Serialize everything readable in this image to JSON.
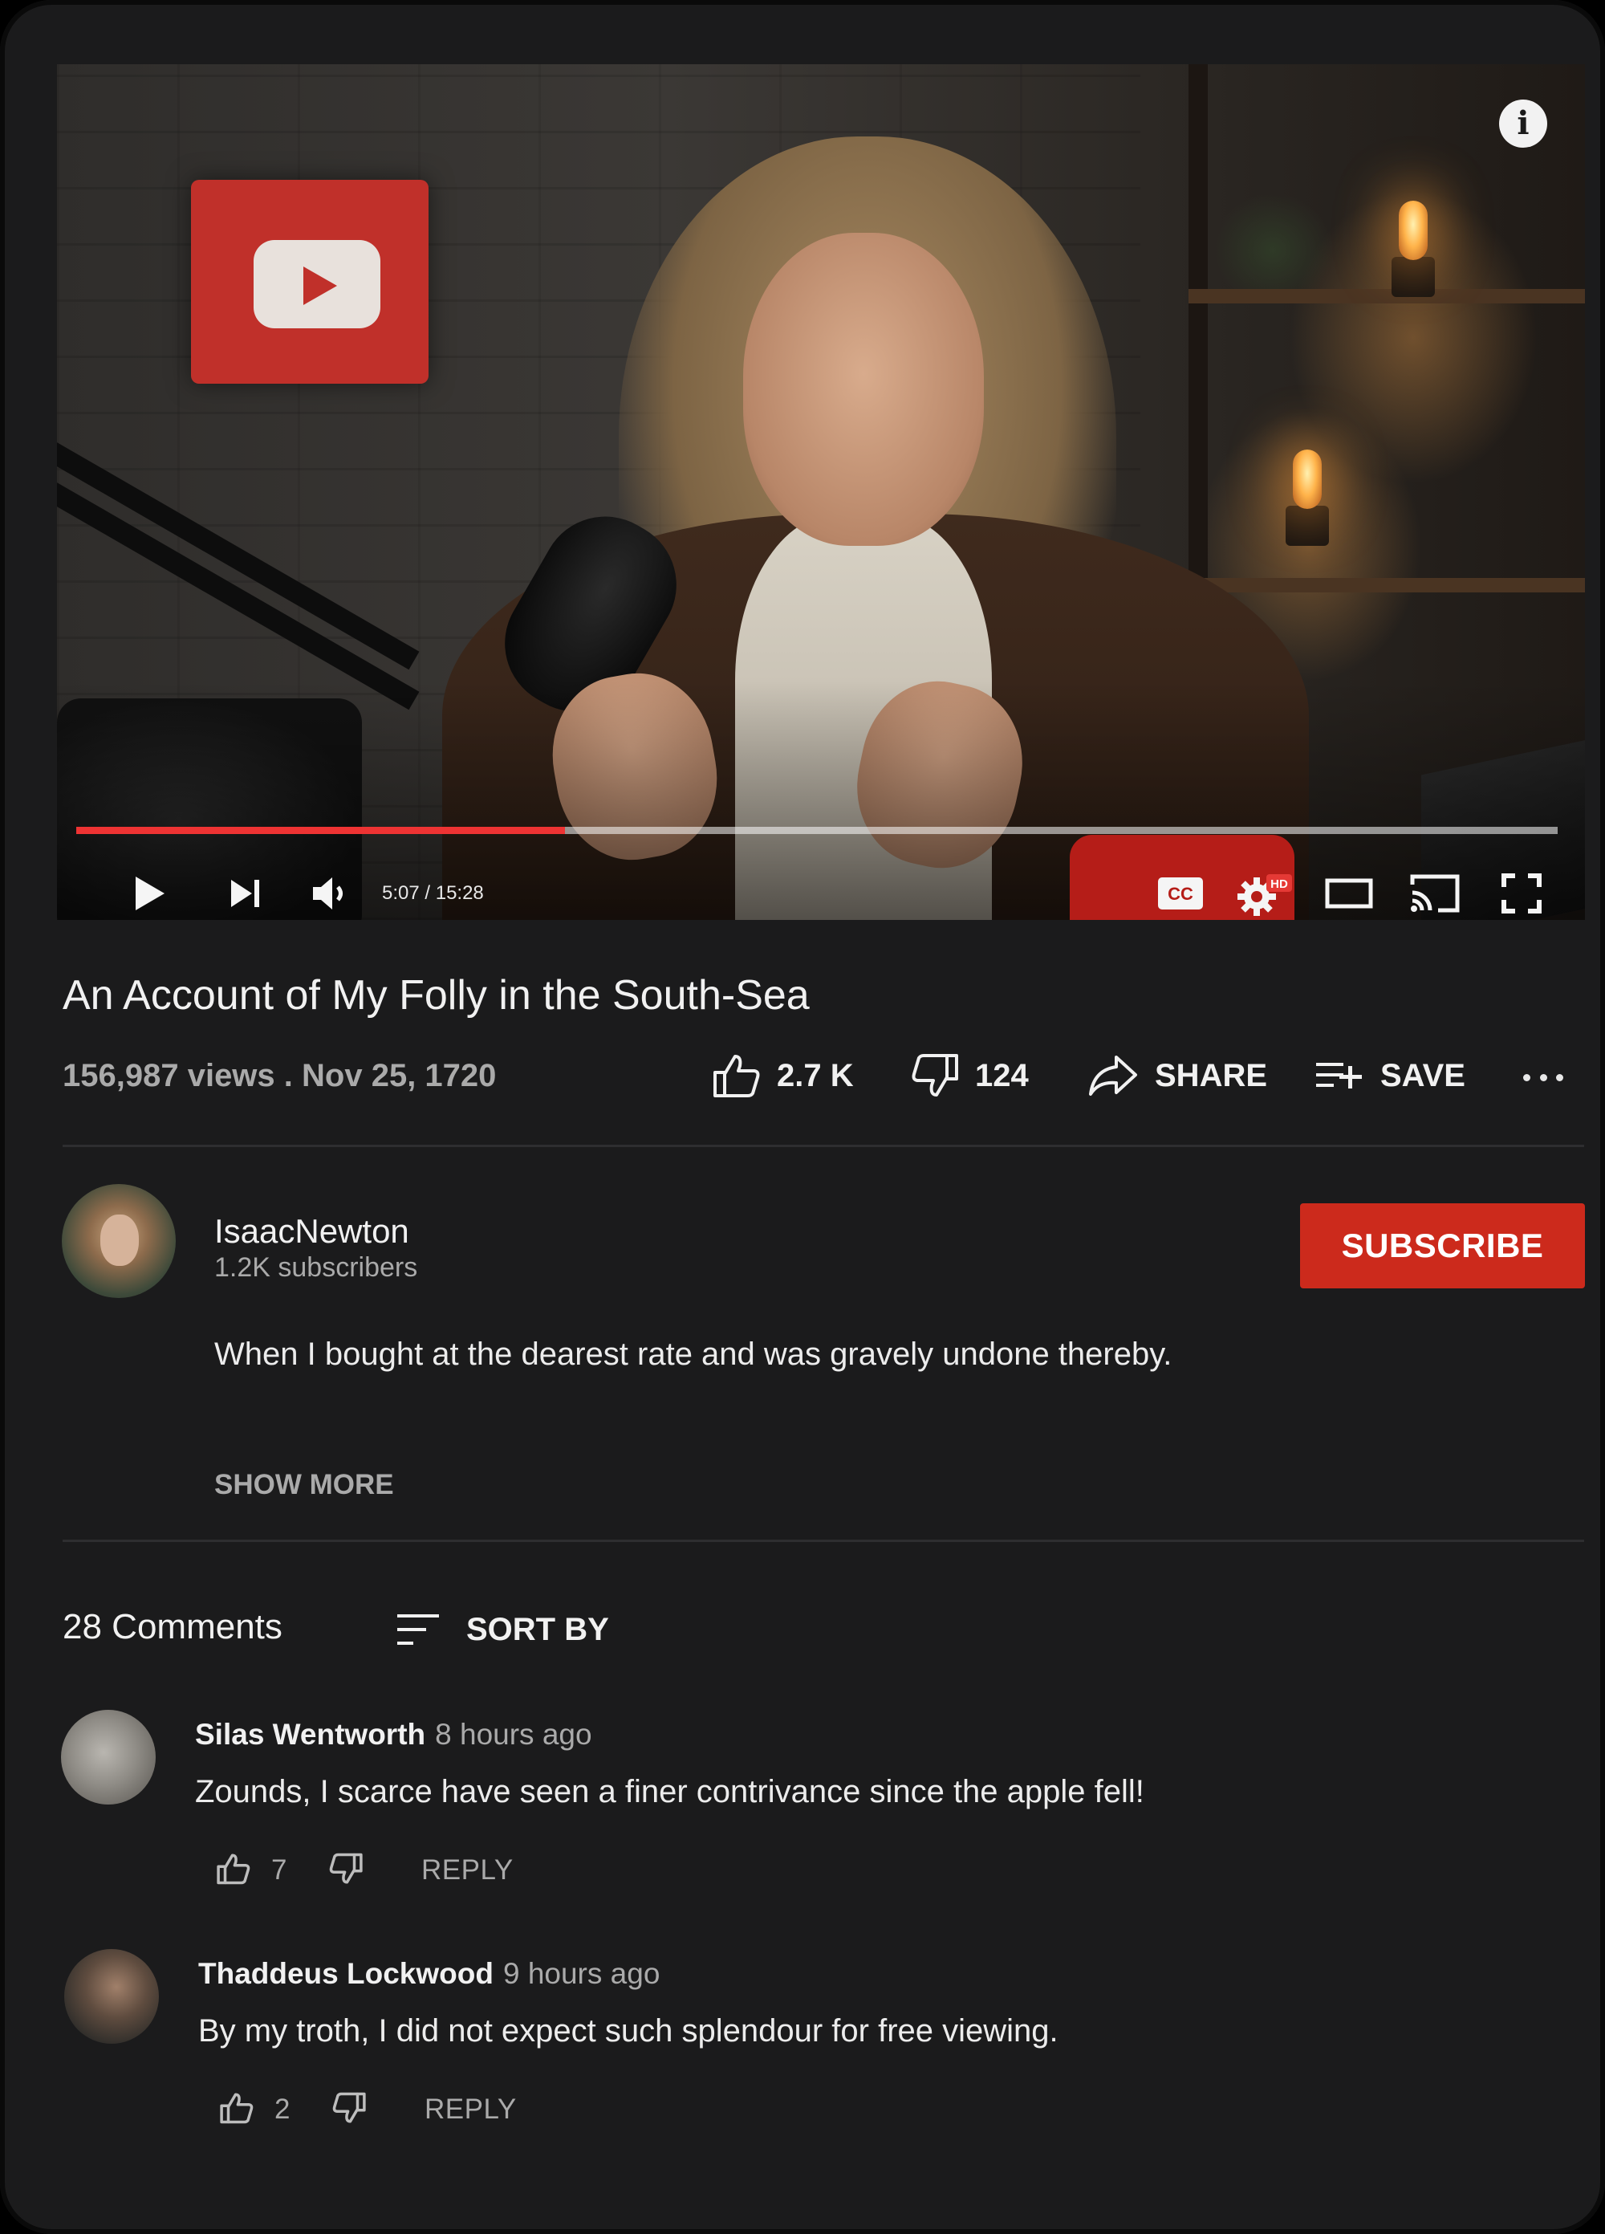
{
  "player": {
    "time_display": "5:07 / 15:28",
    "progress_fraction": 0.33,
    "buffered_fraction": 1.0,
    "icons": [
      "info-icon",
      "play-icon",
      "next-icon",
      "volume-icon",
      "captions-icon",
      "settings-icon",
      "theater-icon",
      "cast-icon",
      "fullscreen-icon"
    ],
    "hd_badge": "HD",
    "cc_label": "CC"
  },
  "video": {
    "title": "An Account of My Folly in the South-Sea",
    "views": "156,987 views",
    "separator": " . ",
    "date": "Nov 25, 1720",
    "likes": "2.7 K",
    "dislikes": "124",
    "share_label": "SHARE",
    "save_label": "SAVE"
  },
  "channel": {
    "name": "IsaacNewton",
    "subscribers": "1.2K subscribers",
    "subscribe_label": "SUBSCRIBE",
    "description": "When I bought at the dearest rate and was gravely undone thereby.",
    "show_more_label": "SHOW MORE"
  },
  "comments": {
    "count_label": "28 Comments",
    "sort_label": "SORT BY",
    "reply_label": "REPLY",
    "items": [
      {
        "author": "Silas Wentworth",
        "time": "8 hours ago",
        "text": "Zounds, I scarce have seen a finer contrivance since the apple fell!",
        "likes": "7"
      },
      {
        "author": "Thaddeus Lockwood",
        "time": "9 hours ago",
        "text": "By my troth, I did not expect such splendour for free viewing.",
        "likes": "2"
      }
    ]
  },
  "colors": {
    "background": "#1b1b1c",
    "accent_red": "#cc2a1c",
    "progress_red": "#ee3333",
    "text_primary": "#f1f1f1",
    "text_secondary": "#aaaaaa"
  }
}
